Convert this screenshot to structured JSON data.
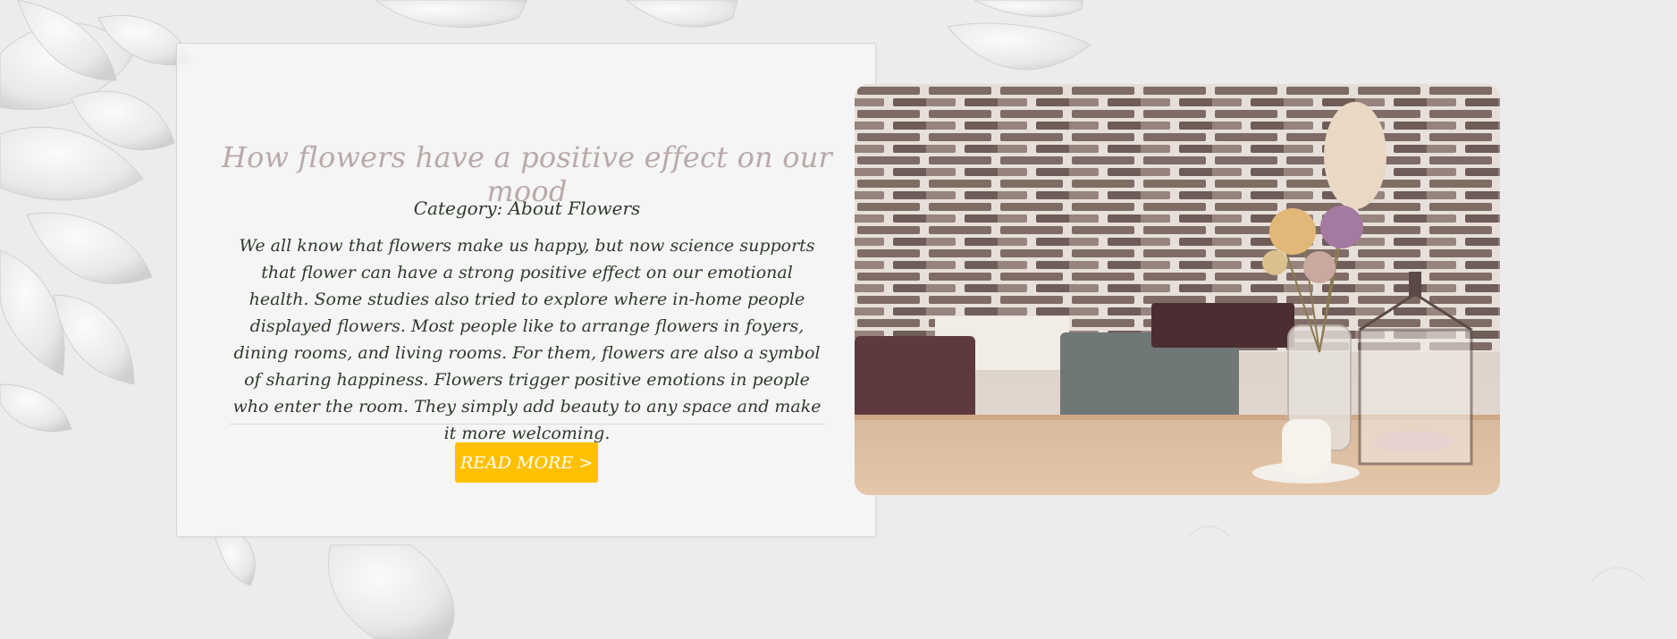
{
  "article": {
    "title": "How flowers have a positive effect on our mood",
    "category": "Category: About Flowers",
    "body": "We all know that flowers make us happy, but now science supports that flower can have a strong positive effect on our emotional health. Some studies also tried to explore where in-home people displayed flowers. Most people like to arrange flowers in foyers, dining rooms, and living rooms. For them, flowers are also a symbol of sharing happiness. Flowers trigger positive emotions in people who enter the room. They simply add beauty to any space and make it more welcoming.",
    "read_more_label": "READ MORE >"
  },
  "colors": {
    "background": "#ececec",
    "title": "#b9a9a9",
    "text": "#2e3a2c",
    "button": "#ffc000",
    "button_text": "#ffffff"
  },
  "images": {
    "background": "paper-flowers-background",
    "photo": "dried-flowers-vase-brick-wall-photo"
  }
}
